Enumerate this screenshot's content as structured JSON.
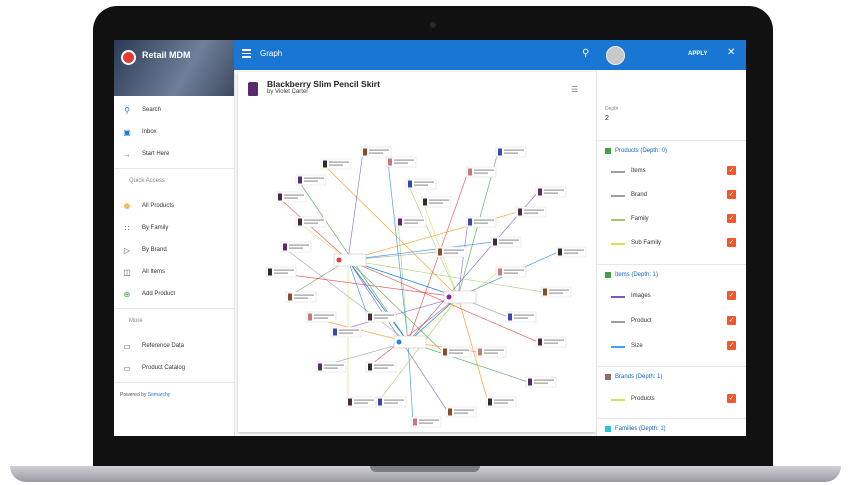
{
  "app": {
    "title": "Retail MDM"
  },
  "topbar": {
    "title": "Graph"
  },
  "sidebar": {
    "items": [
      {
        "label": "Search",
        "icon": "search-icon"
      },
      {
        "label": "Inbox",
        "icon": "inbox-icon"
      },
      {
        "label": "Start Here",
        "icon": "arrow-right-icon"
      }
    ],
    "quick_access_label": "Quick Access",
    "quick_items": [
      {
        "label": "All Products",
        "icon": "products-icon"
      },
      {
        "label": "By Family",
        "icon": "family-icon"
      },
      {
        "label": "By Brand",
        "icon": "brand-icon"
      },
      {
        "label": "All Items",
        "icon": "items-icon"
      },
      {
        "label": "Add Product",
        "icon": "add-icon"
      }
    ],
    "more_label": "More",
    "more_items": [
      {
        "label": "Reference Data",
        "icon": "folder-icon"
      },
      {
        "label": "Product Catalog",
        "icon": "folder-icon"
      }
    ],
    "powered_prefix": "Powered by",
    "powered_brand": "Semarchy"
  },
  "product": {
    "title": "Blackberry Slim Pencil Skirt",
    "subtitle": "by Violet Carter"
  },
  "panel": {
    "apply_label": "APPLY",
    "depth_label": "Depth",
    "depth_value": "2",
    "groups": [
      {
        "label": "Products (Depth: 0)",
        "color": "#43a047",
        "relations": [
          {
            "label": "Items",
            "color": "#9e9e9e"
          },
          {
            "label": "Brand",
            "color": "#9e9e9e"
          },
          {
            "label": "Family",
            "color": "#9ccc65"
          },
          {
            "label": "Sub Family",
            "color": "#d4e157"
          }
        ]
      },
      {
        "label": "Items (Depth: 1)",
        "color": "#43a047",
        "relations": [
          {
            "label": "Images",
            "color": "#7e57c2"
          },
          {
            "label": "Product",
            "color": "#9e9e9e"
          },
          {
            "label": "Size",
            "color": "#42a5f5"
          }
        ]
      },
      {
        "label": "Brands (Depth: 1)",
        "color": "#8d6e63",
        "relations": [
          {
            "label": "Products",
            "color": "#d4e157"
          }
        ]
      },
      {
        "label": "Families (Depth: 1)",
        "color": "#26c6da",
        "relations": []
      }
    ]
  }
}
